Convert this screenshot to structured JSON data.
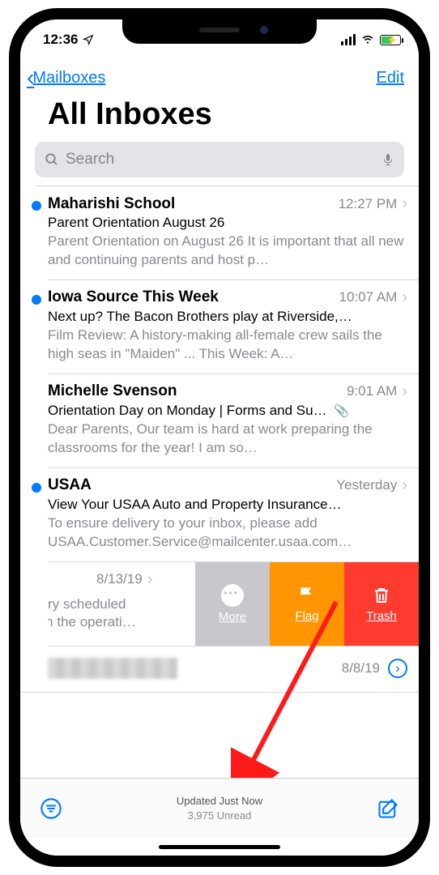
{
  "status": {
    "time": "12:36"
  },
  "nav": {
    "back_label": "Mailboxes",
    "edit_label": "Edit"
  },
  "title": "All Inboxes",
  "search": {
    "placeholder": "Search"
  },
  "emails": [
    {
      "unread": true,
      "sender": "Maharishi School",
      "time": "12:27 PM",
      "subject": "Parent Orientation August 26",
      "preview": "Parent Orientation on August 26 It is important that all new and continuing parents and host p…"
    },
    {
      "unread": true,
      "sender": "Iowa Source This Week",
      "time": "10:07 AM",
      "subject": "Next up? The Bacon Brothers play at Riverside,…",
      "preview": "Film Review: A history-making all-female crew sails the high seas in \"Maiden\" ... This Week: A…"
    },
    {
      "unread": false,
      "sender": "Michelle Svenson",
      "time": "9:01 AM",
      "subject": "Orientation Day on Monday | Forms and Su…",
      "attachment": true,
      "preview": "Dear Parents, Our team is hard at work preparing the classrooms for the year! I am so…"
    },
    {
      "unread": true,
      "sender": "USAA",
      "time": "Yesterday",
      "subject": "View Your USAA Auto and Property Insurance…",
      "preview": "To ensure delivery to your inbox, please add USAA.Customer.Service@mailcenter.usaa.com…"
    }
  ],
  "swiped": {
    "date": "8/13/19",
    "preview_line1": "urgery scheduled",
    "preview_line2": "nts in the operati…",
    "actions": {
      "more": "More",
      "flag": "Flag",
      "trash": "Trash"
    }
  },
  "blurred_row": {
    "date": "8/8/19"
  },
  "toolbar": {
    "status": "Updated Just Now",
    "unread": "3,975 Unread"
  }
}
